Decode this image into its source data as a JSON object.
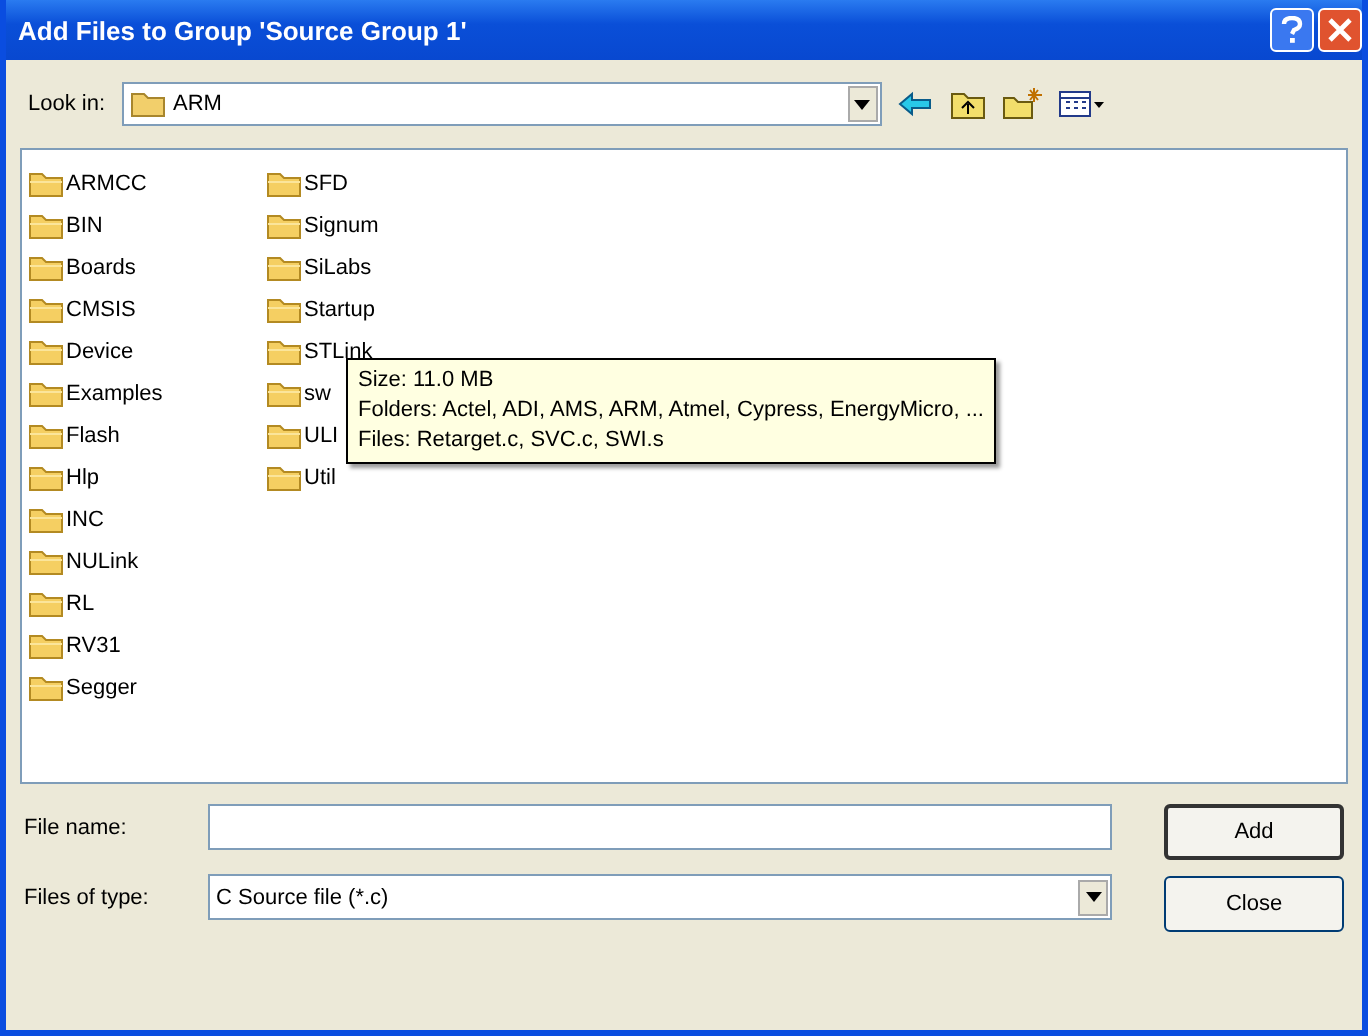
{
  "window": {
    "title": "Add Files to Group 'Source Group 1'"
  },
  "look_in": {
    "label": "Look in:",
    "value": "ARM"
  },
  "folders": [
    {
      "name": "ARMCC"
    },
    {
      "name": "BIN"
    },
    {
      "name": "Boards"
    },
    {
      "name": "CMSIS"
    },
    {
      "name": "Device"
    },
    {
      "name": "Examples"
    },
    {
      "name": "Flash"
    },
    {
      "name": "Hlp"
    },
    {
      "name": "INC"
    },
    {
      "name": "NULink"
    },
    {
      "name": "RL"
    },
    {
      "name": "RV31"
    },
    {
      "name": "Segger"
    },
    {
      "name": "SFD"
    },
    {
      "name": "Signum"
    },
    {
      "name": "SiLabs"
    },
    {
      "name": "Startup"
    },
    {
      "name": "STLink"
    },
    {
      "name": "sw"
    },
    {
      "name": "ULI"
    },
    {
      "name": "Util"
    }
  ],
  "tooltip": {
    "lines": [
      "Size: 11.0 MB",
      "Folders: Actel, ADI, AMS, ARM, Atmel, Cypress, EnergyMicro, ...",
      "Files: Retarget.c, SVC.c, SWI.s"
    ]
  },
  "file_name": {
    "label": "File name:"
  },
  "file_type": {
    "label": "Files of type:",
    "value": "C Source file (*.c)"
  },
  "buttons": [
    "Add",
    "Close"
  ]
}
